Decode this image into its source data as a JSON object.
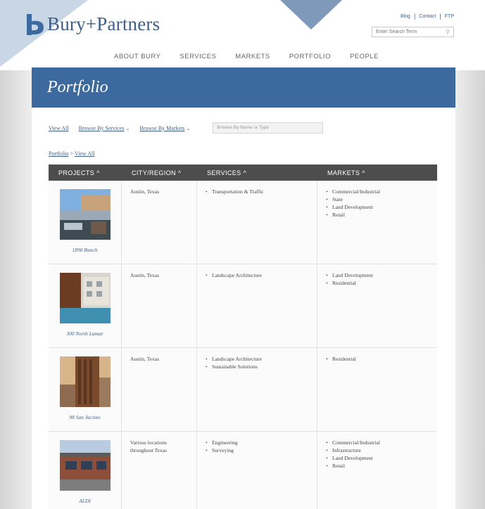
{
  "header": {
    "logo_text": "Bury+Partners",
    "util_links": [
      "Blog",
      "Contact",
      "FTP"
    ],
    "search_placeholder": "Enter Search Term"
  },
  "nav": [
    "ABOUT BURY",
    "SERVICES",
    "MARKETS",
    "PORTFOLIO",
    "PEOPLE"
  ],
  "page": {
    "title": "Portfolio",
    "browse": {
      "view_all": "View All",
      "by_services": "Browse By Services",
      "by_markets": "Browse By Markets",
      "name_search_placeholder": "Browse By Name or Type"
    },
    "breadcrumb": {
      "root": "Portfolio",
      "sep": ">",
      "current": "View All"
    }
  },
  "table": {
    "headers": [
      "PROJECTS ^",
      "CITY/REGION ^",
      "SERVICES ^",
      "MARKETS ^"
    ],
    "rows": [
      {
        "name": "1890 Ranch",
        "city": "Austin, Texas",
        "services": [
          "Transportation & Traffic"
        ],
        "markets": [
          "Commercial/Industrial",
          "State",
          "Land Development",
          "Retail"
        ]
      },
      {
        "name": "300 North Lamar",
        "city": "Austin, Texas",
        "services": [
          "Landscape Architecture"
        ],
        "markets": [
          "Land Development",
          "Residential"
        ]
      },
      {
        "name": "98 San Jacinto",
        "city": "Austin, Texas",
        "services": [
          "Landscape Architecture",
          "Sustainable Solutions"
        ],
        "markets": [
          "Residential"
        ]
      },
      {
        "name": "ALDI",
        "city": "Various locations throughout Texas",
        "services": [
          "Engineering",
          "Surveying"
        ],
        "markets": [
          "Commercial/Industrial",
          "Infrastructure",
          "Land Development",
          "Retail"
        ]
      }
    ]
  },
  "colors": {
    "brand_blue": "#3c6a9e",
    "link_blue": "#3f5f87",
    "header_dark": "#4d4d4d"
  }
}
